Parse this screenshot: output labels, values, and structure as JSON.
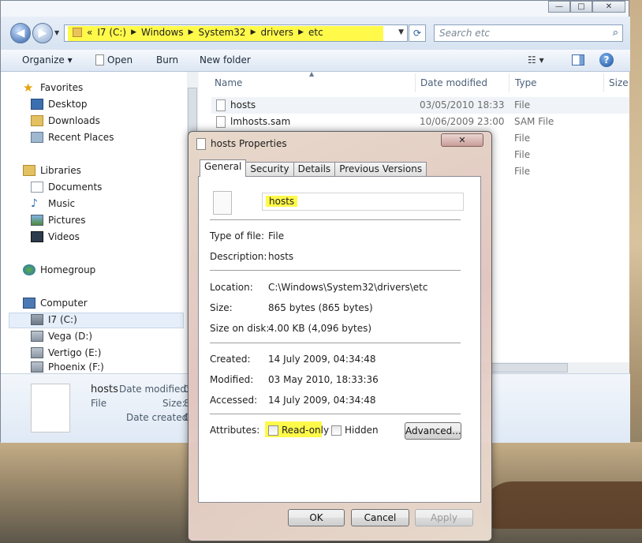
{
  "explorer": {
    "title_buttons": [
      "—",
      "□",
      "✕"
    ],
    "address": {
      "overflow": "«",
      "crumbs": [
        "I7 (C:)",
        "Windows",
        "System32",
        "drivers",
        "etc"
      ]
    },
    "search": {
      "placeholder": "Search etc"
    },
    "toolbar": {
      "organize": "Organize ▾",
      "open": "Open",
      "burn": "Burn",
      "new_folder": "New folder"
    },
    "nav": {
      "favorites": "Favorites",
      "desktop": "Desktop",
      "downloads": "Downloads",
      "recent_places": "Recent Places",
      "libraries": "Libraries",
      "documents": "Documents",
      "music": "Music",
      "pictures": "Pictures",
      "videos": "Videos",
      "homegroup": "Homegroup",
      "computer": "Computer",
      "drive_c": "I7 (C:)",
      "drive_d": "Vega (D:)",
      "drive_e": "Vertigo (E:)",
      "drive_f": "Phoenix (F:)"
    },
    "columns": {
      "name": "Name",
      "date_modified": "Date modified",
      "type": "Type",
      "size": "Size"
    },
    "files": [
      {
        "name": "hosts",
        "date": "03/05/2010 18:33",
        "type": "File"
      },
      {
        "name": "lmhosts.sam",
        "date": "10/06/2009 23:00",
        "type": "SAM File"
      },
      {
        "name": "",
        "date": "",
        "type": "File"
      },
      {
        "name": "",
        "date": "",
        "type": "File"
      },
      {
        "name": "",
        "date": "",
        "type": "File"
      }
    ],
    "details": {
      "name": "hosts",
      "type": "File",
      "date_modified_label": "Date modified:",
      "date_modified_value": "0",
      "size_label": "Size:",
      "size_value": "8",
      "date_created_label": "Date created:",
      "date_created_value": "0"
    }
  },
  "dialog": {
    "title": "hosts Properties",
    "close": "✕",
    "tabs": [
      "General",
      "Security",
      "Details",
      "Previous Versions"
    ],
    "file_name": "hosts",
    "type_label": "Type of file:",
    "type_value": "File",
    "description_label": "Description:",
    "description_value": "hosts",
    "location_label": "Location:",
    "location_value": "C:\\Windows\\System32\\drivers\\etc",
    "size_label": "Size:",
    "size_value": "865 bytes (865 bytes)",
    "size_on_disk_label": "Size on disk:",
    "size_on_disk_value": "4.00 KB (4,096 bytes)",
    "created_label": "Created:",
    "created_value": "14 July 2009, 04:34:48",
    "modified_label": "Modified:",
    "modified_value": "03 May 2010, 18:33:36",
    "accessed_label": "Accessed:",
    "accessed_value": "14 July 2009, 04:34:48",
    "attributes_label": "Attributes:",
    "readonly_label": "Read-only",
    "hidden_label": "Hidden",
    "advanced": "Advanced...",
    "ok": "OK",
    "cancel": "Cancel",
    "apply": "Apply"
  },
  "colors": {
    "highlight": "#fff94a",
    "accent": "#1e4c8a"
  }
}
